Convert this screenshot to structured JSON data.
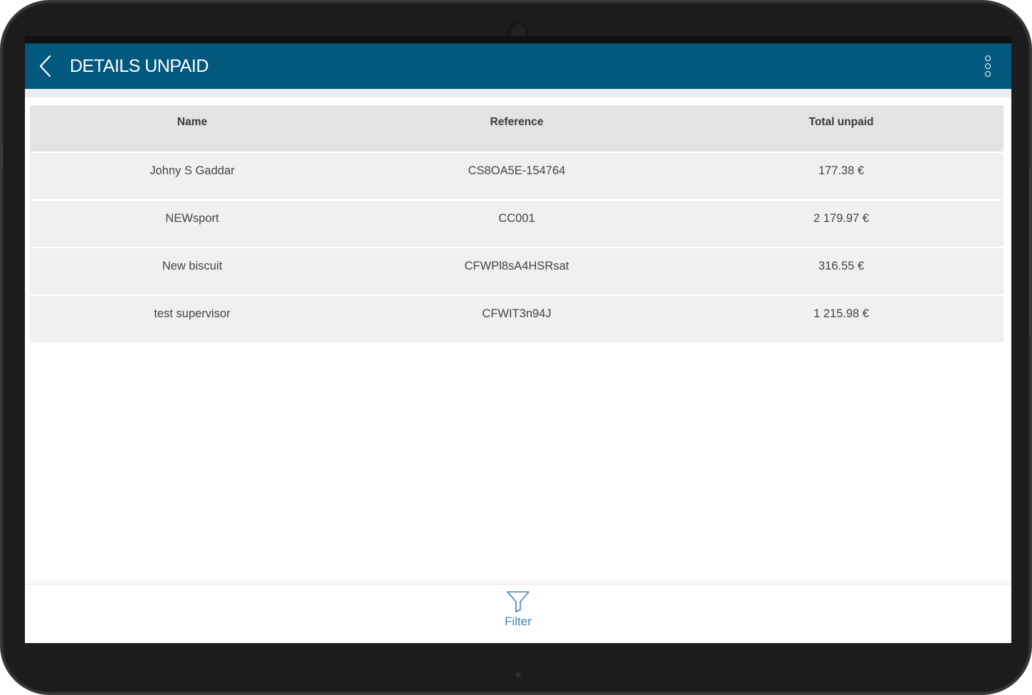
{
  "app": {
    "title": "DETAILS UNPAID"
  },
  "icons": {
    "back": "chevron-left-icon",
    "more": "more-vertical-icon",
    "filter": "filter-funnel-icon"
  },
  "colors": {
    "appbar": "#02587d",
    "filter_accent": "#3f86a9"
  },
  "table": {
    "headers": {
      "name": "Name",
      "reference": "Reference",
      "total": "Total unpaid"
    },
    "rows": [
      {
        "name": "Johny S Gaddar",
        "reference": "CS8OA5E-154764",
        "total": "177.38 €"
      },
      {
        "name": "NEWsport",
        "reference": "CC001",
        "total": "2 179.97 €"
      },
      {
        "name": "New biscuit",
        "reference": "CFWPl8sA4HSRsat",
        "total": "316.55 €"
      },
      {
        "name": "test supervisor",
        "reference": "CFWIT3n94J",
        "total": "1 215.98 €"
      }
    ]
  },
  "bottom": {
    "filter_label": "Filter"
  }
}
